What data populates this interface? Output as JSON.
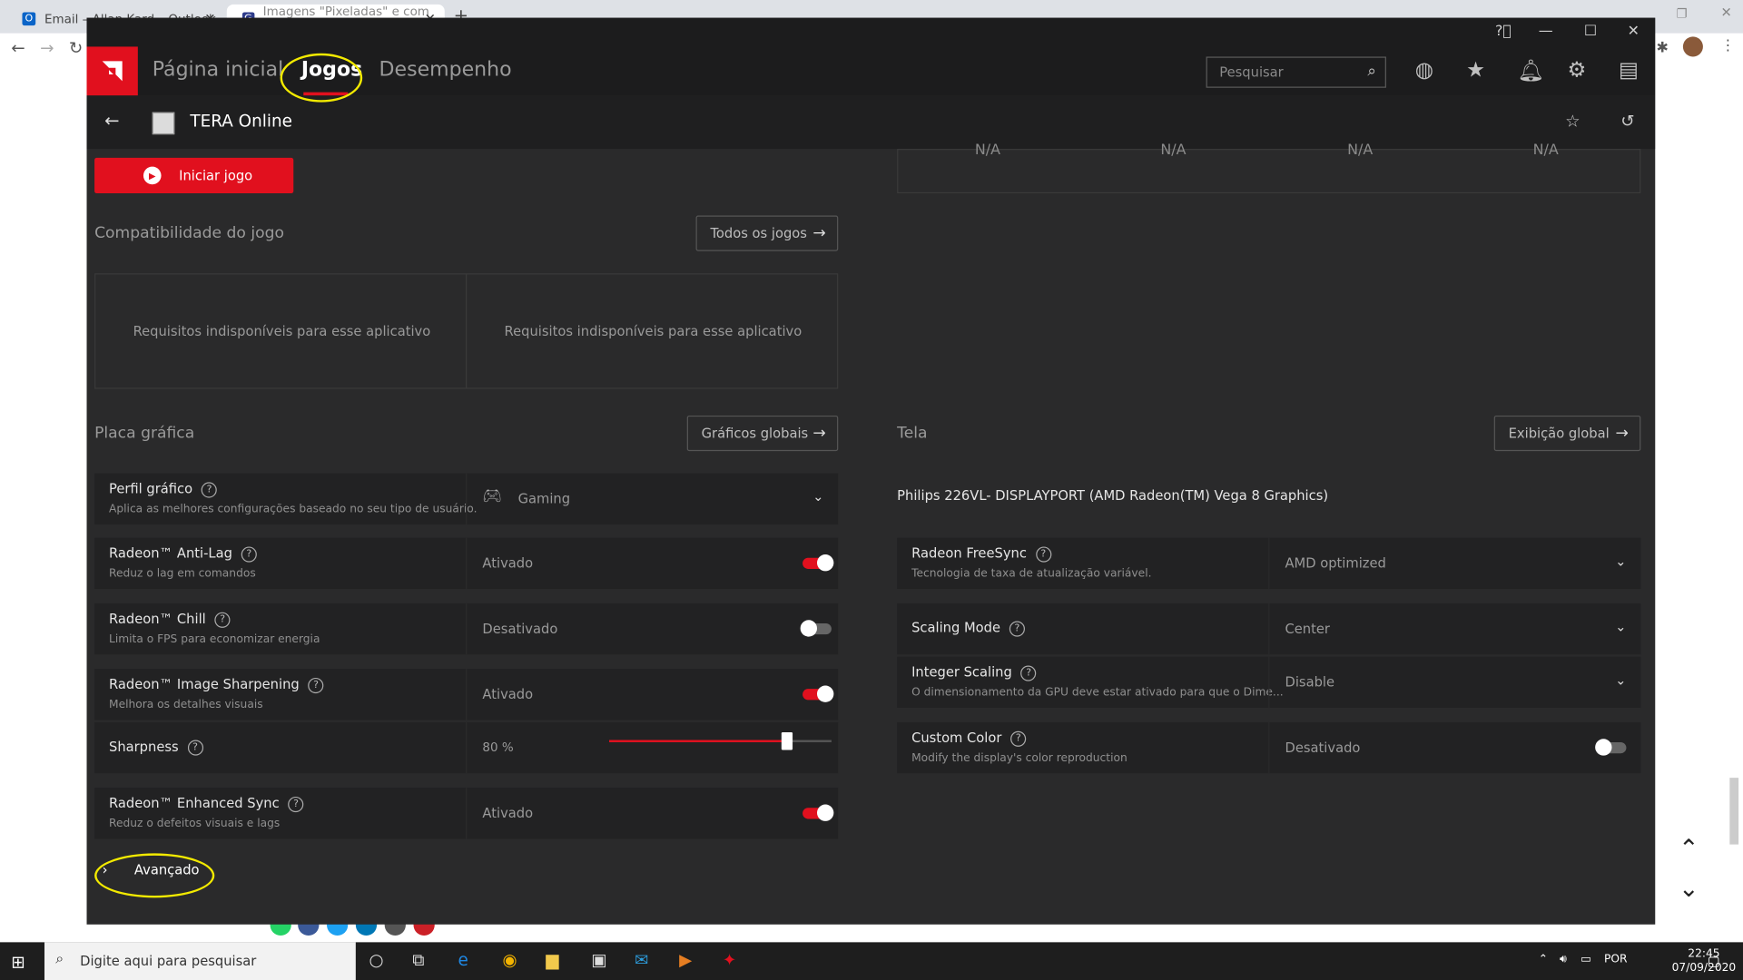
{
  "browser": {
    "tab1_title": "Email – Allan Kard – Outlook",
    "tab2_title": "Imagens \"Pixeladas\" e com erro...",
    "new_tab": "+"
  },
  "amd": {
    "nav": {
      "home": "Página inicial",
      "games": "Jogos",
      "performance": "Desempenho"
    },
    "search_placeholder": "Pesquisar",
    "game_title": "TERA Online",
    "launch_button": "Iniciar jogo",
    "na_values": [
      "N/A",
      "N/A",
      "N/A",
      "N/A"
    ],
    "compat": {
      "title": "Compatibilidade do jogo",
      "all_games_button": "Todos os jogos",
      "left_text": "Requisitos indisponíveis para esse aplicativo",
      "right_text": "Requisitos indisponíveis para esse aplicativo"
    },
    "graphics": {
      "title": "Placa gráfica",
      "global_button": "Gráficos globais",
      "rows": [
        {
          "label": "Perfil gráfico",
          "sub": "Aplica as melhores configurações baseado no seu tipo de usuário.",
          "value": "Gaming"
        },
        {
          "label": "Radeon™ Anti-Lag",
          "sub": "Reduz o lag em comandos",
          "value": "Ativado"
        },
        {
          "label": "Radeon™ Chill",
          "sub": "Limita o FPS para economizar energia",
          "value": "Desativado"
        },
        {
          "label": "Radeon™ Image Sharpening",
          "sub": "Melhora os detalhes visuais",
          "value": "Ativado"
        },
        {
          "label": "Sharpness",
          "sub": "",
          "value": "80 %"
        },
        {
          "label": "Radeon™ Enhanced Sync",
          "sub": "Reduz o defeitos visuais e lags",
          "value": "Ativado"
        }
      ],
      "sharpness_level": 0.8,
      "advanced": "Avançado"
    },
    "display": {
      "title": "Tela",
      "global_button": "Exibição global",
      "monitor": "Philips 226VL- DISPLAYPORT (AMD Radeon(TM) Vega 8 Graphics)",
      "rows": [
        {
          "label": "Radeon FreeSync",
          "sub": "Tecnologia de taxa de atualização variável.",
          "value": "AMD optimized"
        },
        {
          "label": "Scaling Mode",
          "sub": "",
          "value": "Center"
        },
        {
          "label": "Integer Scaling",
          "sub": "O dimensionamento da GPU deve estar ativado para que o Dime...",
          "value": "Disable"
        },
        {
          "label": "Custom Color",
          "sub": "Modify the display's color reproduction",
          "value": "Desativado"
        }
      ]
    },
    "accent_color": "#e1101e",
    "highlight_color": "#f3ea00"
  },
  "taskbar": {
    "search": "Digite aqui para pesquisar",
    "lang": "POR",
    "time": "22:45",
    "date": "07/09/2020"
  }
}
